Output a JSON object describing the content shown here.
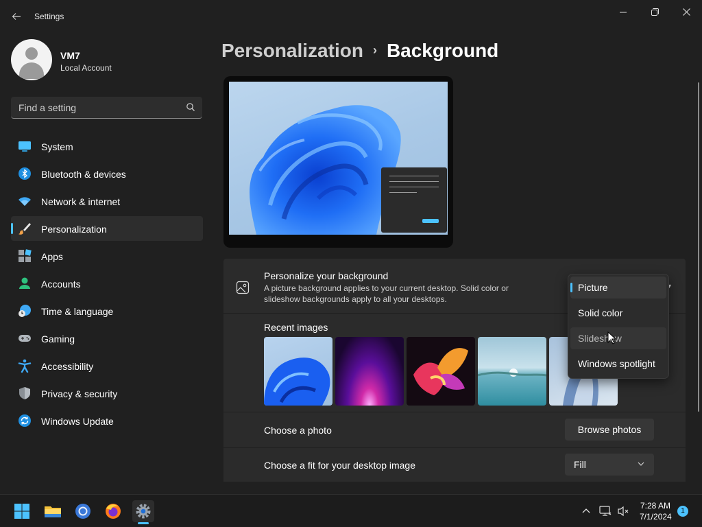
{
  "window": {
    "title": "Settings",
    "back_icon": "back-arrow-icon",
    "controls": [
      "minimize-icon",
      "restore-icon",
      "close-icon"
    ]
  },
  "profile": {
    "name": "VM7",
    "account_type": "Local Account"
  },
  "search": {
    "placeholder": "Find a setting"
  },
  "sidebar": {
    "items": [
      {
        "label": "System",
        "icon": "system-icon"
      },
      {
        "label": "Bluetooth & devices",
        "icon": "bluetooth-icon"
      },
      {
        "label": "Network & internet",
        "icon": "wifi-icon"
      },
      {
        "label": "Personalization",
        "icon": "brush-icon",
        "active": true
      },
      {
        "label": "Apps",
        "icon": "apps-icon"
      },
      {
        "label": "Accounts",
        "icon": "accounts-icon"
      },
      {
        "label": "Time & language",
        "icon": "clock-globe-icon"
      },
      {
        "label": "Gaming",
        "icon": "gamepad-icon"
      },
      {
        "label": "Accessibility",
        "icon": "accessibility-icon"
      },
      {
        "label": "Privacy & security",
        "icon": "shield-icon"
      },
      {
        "label": "Windows Update",
        "icon": "update-icon"
      }
    ]
  },
  "breadcrumb": {
    "parent": "Personalization",
    "separator": "›",
    "current": "Background"
  },
  "background_card": {
    "title": "Personalize your background",
    "description": "A picture background applies to your current desktop. Solid color or slideshow backgrounds apply to all your desktops.",
    "recent_title": "Recent images"
  },
  "dropdown": {
    "options": [
      "Picture",
      "Solid color",
      "Slideshow",
      "Windows spotlight"
    ],
    "selected": "Picture",
    "hovered": "Slideshow"
  },
  "photo_row": {
    "label": "Choose a photo",
    "button": "Browse photos"
  },
  "fit_row": {
    "label": "Choose a fit for your desktop image",
    "value": "Fill"
  },
  "taskbar": {
    "apps": [
      "start-icon",
      "file-explorer-icon",
      "chrome-icon",
      "firefox-icon",
      "settings-icon"
    ],
    "time": "7:28 AM",
    "date": "7/1/2024",
    "notification_count": "1"
  },
  "colors": {
    "accent": "#4cc2ff",
    "background": "#202020",
    "card": "#2b2b2b"
  }
}
